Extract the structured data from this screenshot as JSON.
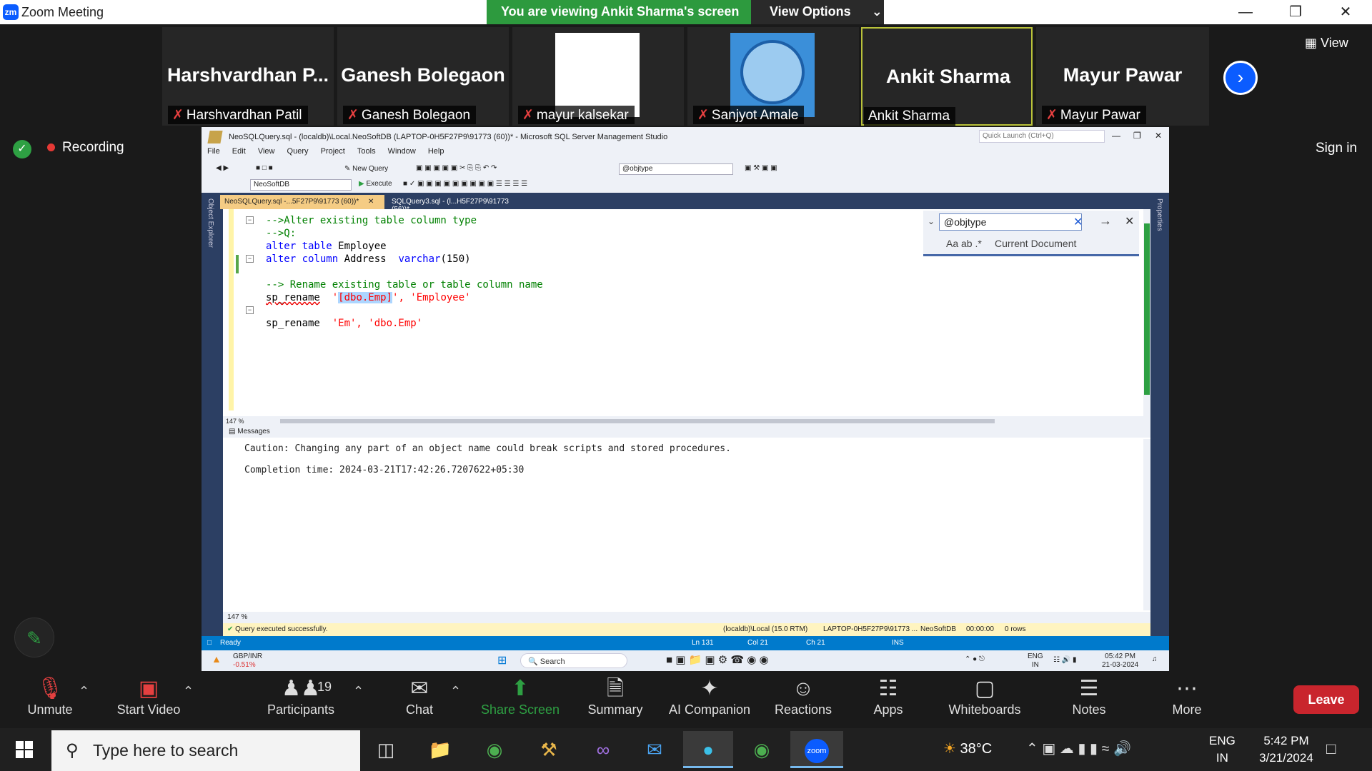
{
  "window": {
    "title": "Zoom Meeting",
    "logo_text": "zm"
  },
  "share_banner": {
    "message": "You are viewing Ankit Sharma's screen",
    "view_options": "View Options"
  },
  "participants": [
    {
      "big": "Harshvardhan  P...",
      "label": "Harshvardhan Patil",
      "muted": true
    },
    {
      "big": "Ganesh Bolegaon",
      "label": "Ganesh Bolegaon",
      "muted": true
    },
    {
      "big": "",
      "label": "mayur kalsekar",
      "muted": true
    },
    {
      "big": "",
      "label": "Sanjyot Amale",
      "muted": true
    },
    {
      "big": "Ankit Sharma",
      "label": "Ankit Sharma",
      "muted": false
    },
    {
      "big": "Mayur Pawar",
      "label": "Mayur Pawar",
      "muted": true
    }
  ],
  "view_button": "View",
  "recording_label": "Recording",
  "sign_in": "Sign in",
  "ssms": {
    "title": "NeoSQLQuery.sql - (localdb)\\Local.NeoSoftDB (LAPTOP-0H5F27P9\\91773 (60))* - Microsoft SQL Server Management Studio",
    "quick_launch": "Quick Launch (Ctrl+Q)",
    "menu": [
      "File",
      "Edit",
      "View",
      "Query",
      "Project",
      "Tools",
      "Window",
      "Help"
    ],
    "new_query": "New Query",
    "objtype_combo": "@objtype",
    "db_combo": "NeoSoftDB",
    "execute": "Execute",
    "object_explorer": "Object Explorer",
    "properties": "Properties",
    "tabs": [
      "NeoSQLQuery.sql -...5F27P9\\91773 (60))*",
      "SQLQuery3.sql - (l...H5F27P9\\91773 (56))*"
    ],
    "code": {
      "l1": "-->Alter existing table column type",
      "l2": "-->Q:",
      "l3a": "alter table ",
      "l3b": "Employee",
      "l4a": "alter column ",
      "l4b": "Address  ",
      "l4c": "varchar",
      "l4d": "(150)",
      "l6": "--> Rename existing table or table column name",
      "l7a": "sp_rename",
      "l7b": "  '",
      "l7c": "[dbo.Emp]",
      "l7d": "', 'Employee'",
      "l9a": "sp_rename",
      "l9b": "  'Em', 'dbo.Emp'"
    },
    "find": {
      "value": "@objtype",
      "scope": "Current Document",
      "opts": "Aa  ab  .*"
    },
    "zoom": "147 %",
    "messages_tab": "Messages",
    "messages": [
      "Caution: Changing any part of an object name could break scripts and stored procedures.",
      "Completion time: 2024-03-21T17:42:26.7207622+05:30"
    ],
    "query_status": "Query executed successfully.",
    "query_status_right": [
      "(localdb)\\Local (15.0 RTM)",
      "LAPTOP-0H5F27P9\\91773 ...",
      "NeoSoftDB",
      "00:00:00",
      "0 rows"
    ],
    "status": {
      "ready": "Ready",
      "ln": "Ln 131",
      "col": "Col 21",
      "ch": "Ch 21",
      "ins": "INS"
    }
  },
  "remote_taskbar": {
    "ticker": "GBP/INR",
    "ticker_change": "-0.51%",
    "search": "Search",
    "lang": "ENG",
    "region": "IN",
    "time": "05:42 PM",
    "date": "21-03-2024"
  },
  "zoom_toolbar": [
    {
      "icon": "mic-muted-icon",
      "label": "Unmute"
    },
    {
      "icon": "video-off-icon",
      "label": "Start Video"
    },
    {
      "icon": "participants-icon",
      "label": "Participants",
      "count": "19"
    },
    {
      "icon": "chat-icon",
      "label": "Chat"
    },
    {
      "icon": "share-screen-icon",
      "label": "Share Screen"
    },
    {
      "icon": "summary-icon",
      "label": "Summary"
    },
    {
      "icon": "ai-companion-icon",
      "label": "AI Companion"
    },
    {
      "icon": "reactions-icon",
      "label": "Reactions"
    },
    {
      "icon": "apps-icon",
      "label": "Apps"
    },
    {
      "icon": "whiteboards-icon",
      "label": "Whiteboards"
    },
    {
      "icon": "notes-icon",
      "label": "Notes"
    },
    {
      "icon": "more-icon",
      "label": "More"
    }
  ],
  "leave": "Leave",
  "taskbar": {
    "search_placeholder": "Type here to search",
    "weather": "38°C",
    "lang": "ENG",
    "region": "IN",
    "time": "5:42 PM",
    "date": "3/21/2024"
  },
  "colors": {
    "accent": "#0b5cff",
    "share_green": "#2d9a3e",
    "leave_red": "#c9252d",
    "ssms_status": "#007acc"
  }
}
